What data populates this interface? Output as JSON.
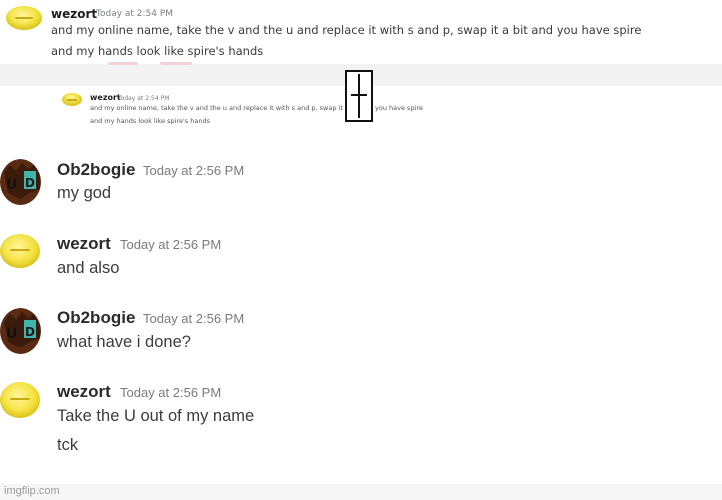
{
  "top_message": {
    "username": "wezort",
    "timestamp": "Today at 2:54 PM",
    "lines": [
      "and my online name, take the v and the u and replace it with s and p, swap it a bit and you have spire",
      "and my hands look like spire's hands"
    ]
  },
  "quoted_message": {
    "username": "wezort",
    "timestamp": "Today at 2:54 PM",
    "lines": [
      "and my online name, take the v and the u and replace it with s and p, swap it",
      "you have spire",
      "and my hands look like spire's hands"
    ]
  },
  "messages": [
    {
      "username": "Ob2bogie",
      "timestamp": "Today at 2:56 PM",
      "lines": [
        "my god"
      ]
    },
    {
      "username": "wezort",
      "timestamp": "Today at 2:56 PM",
      "lines": [
        "and also"
      ]
    },
    {
      "username": "Ob2bogie",
      "timestamp": "Today at 2:56 PM",
      "lines": [
        "what have i done?"
      ]
    },
    {
      "username": "wezort",
      "timestamp": "Today at 2:56 PM",
      "lines": [
        "Take the U out of my name",
        "tck"
      ]
    }
  ],
  "watermark": "imgflip.com",
  "colors": {
    "wezort_avatar": "#f4e23a",
    "ob2bogie_avatar_brown": "#5a2a12",
    "ob2bogie_avatar_teal": "#3fb5ad",
    "divider_band": "#f3f3f4"
  },
  "icons": [
    "wezort-avatar",
    "ob2bogie-avatar",
    "text-cursor-ibeam-icon"
  ]
}
